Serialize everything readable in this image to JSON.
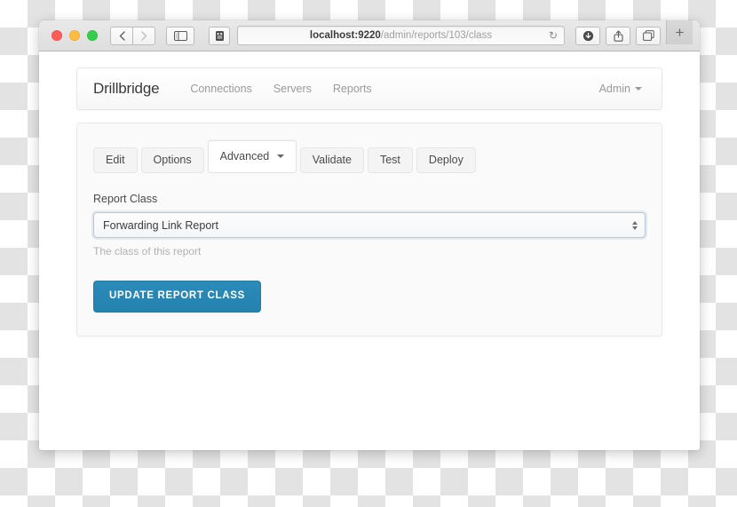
{
  "browser": {
    "traffic_lights": [
      "close",
      "minimize",
      "zoom"
    ],
    "back_label": "‹",
    "forward_label": "›",
    "sidebar_icon": "sidebar-icon",
    "reader_icon": "reader-icon",
    "url_host": "localhost:9220",
    "url_path": "/admin/reports/103/class",
    "url_full": "localhost:9220/admin/reports/103/class",
    "reload_label": "↻",
    "download_icon": "download-icon",
    "share_icon": "share-icon",
    "tabs_icon": "tab-overview-icon",
    "new_tab_label": "+"
  },
  "navbar": {
    "brand": "Drillbridge",
    "links": [
      {
        "label": "Connections"
      },
      {
        "label": "Servers"
      },
      {
        "label": "Reports"
      }
    ],
    "admin_label": "Admin"
  },
  "panel": {
    "tabs": [
      {
        "label": "Edit",
        "active": false,
        "has_caret": false
      },
      {
        "label": "Options",
        "active": false,
        "has_caret": false
      },
      {
        "label": "Advanced",
        "active": true,
        "has_caret": true
      },
      {
        "label": "Validate",
        "active": false,
        "has_caret": false
      },
      {
        "label": "Test",
        "active": false,
        "has_caret": false
      },
      {
        "label": "Deploy",
        "active": false,
        "has_caret": false
      }
    ],
    "form": {
      "field_label": "Report Class",
      "select_value": "Forwarding Link Report",
      "help_text": "The class of this report",
      "submit_label": "UPDATE REPORT CLASS"
    }
  },
  "colors": {
    "accent_blue": "#2482af",
    "select_border": "#b9c6d2",
    "panel_bg": "#fafafa",
    "muted_text": "#9a9a9a"
  }
}
